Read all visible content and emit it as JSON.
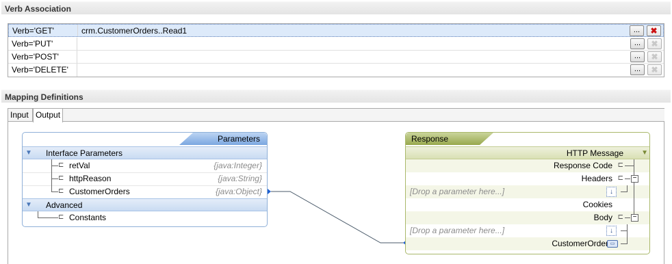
{
  "verb_section": {
    "title": "Verb Association",
    "rows": [
      {
        "verb": "Verb='GET'",
        "operation": "crm.CustomerOrders..Read1",
        "ellipsis": "...",
        "delete": "✖"
      },
      {
        "verb": "Verb='PUT'",
        "operation": "",
        "ellipsis": "...",
        "delete": "✖"
      },
      {
        "verb": "Verb='POST'",
        "operation": "",
        "ellipsis": "...",
        "delete": "✖"
      },
      {
        "verb": "Verb='DELETE'",
        "operation": "",
        "ellipsis": "...",
        "delete": "✖"
      }
    ]
  },
  "mapping_section": {
    "title": "Mapping Definitions",
    "tabs": [
      {
        "label": "Input"
      },
      {
        "label": "Output"
      }
    ],
    "active_tab": "Output"
  },
  "parameters_panel": {
    "title": "Parameters",
    "groups": [
      {
        "label": "Interface Parameters",
        "items": [
          {
            "name": "retVal",
            "type": "{java:Integer}"
          },
          {
            "name": "httpReason",
            "type": "{java:String}"
          },
          {
            "name": "CustomerOrders",
            "type": "{java:Object}"
          }
        ]
      },
      {
        "label": "Advanced",
        "items": [
          {
            "name": "Constants",
            "type": ""
          }
        ]
      }
    ]
  },
  "response_panel": {
    "title": "Response",
    "group_label": "HTTP Message",
    "rows": [
      {
        "label": "Response Code"
      },
      {
        "label": "Headers"
      },
      {
        "drop": "[Drop a parameter here...]"
      },
      {
        "label": "Cookies"
      },
      {
        "label": "Body"
      },
      {
        "drop": "[Drop a parameter here...]"
      },
      {
        "label": "CustomerOrders"
      }
    ]
  },
  "icons": {
    "collapse_triangle": "triangle-down-icon",
    "tree_node": "tree-node-icon",
    "expander_minus": "minus-icon",
    "drop_arrow": "down-arrow-icon",
    "object_icon": "object-icon"
  },
  "colors": {
    "param_accent": "#7ba7e0",
    "response_accent": "#98a84e",
    "delete_active": "#cc1111"
  }
}
